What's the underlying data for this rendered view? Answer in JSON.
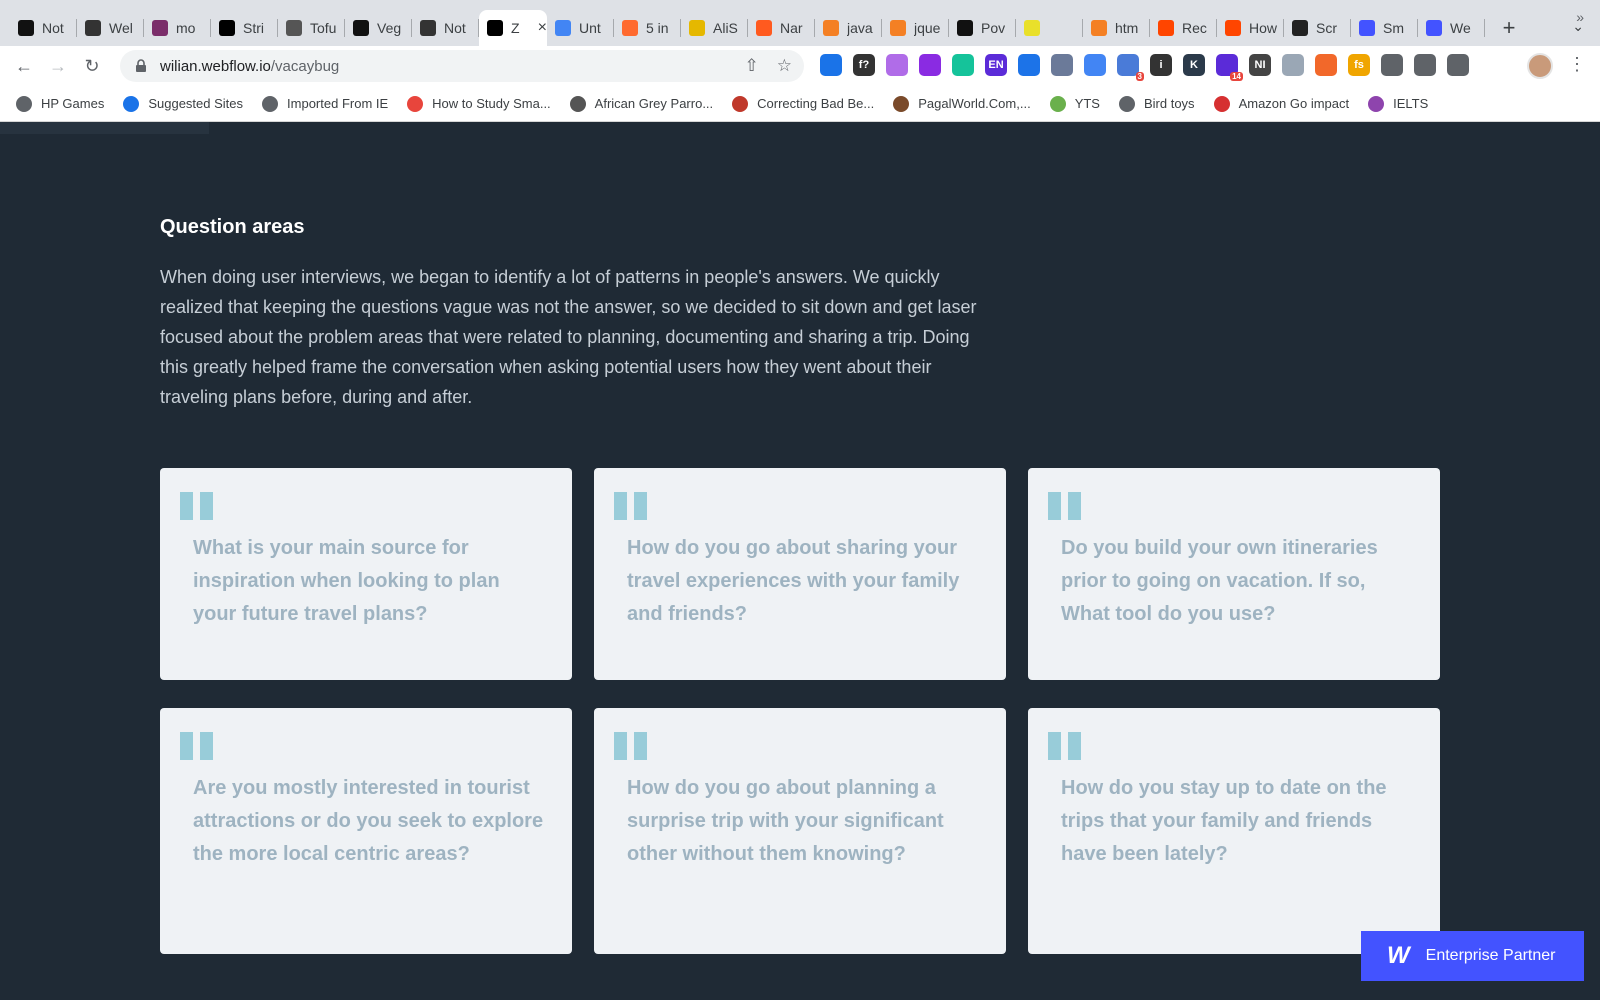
{
  "browser": {
    "tabs": [
      {
        "label": "Not",
        "icon": "notion-black-icon",
        "color": "#111111"
      },
      {
        "label": "Wel",
        "icon": "notion-icon",
        "color": "#333333"
      },
      {
        "label": "mo",
        "icon": "triangle-logo-icon",
        "color": "#7b2d6a"
      },
      {
        "label": "Stri",
        "icon": "wix-icon",
        "color": "#000000"
      },
      {
        "label": "Tofu",
        "icon": "book-icon",
        "color": "#555555"
      },
      {
        "label": "Veg",
        "icon": "k-circle-icon",
        "color": "#111111"
      },
      {
        "label": "Not",
        "icon": "hexagon-icon",
        "color": "#333333"
      },
      {
        "label": "Z",
        "icon": "z-logo-icon",
        "color": "#000000"
      },
      {
        "label": "Unt",
        "icon": "google-docs-icon",
        "color": "#4285f4"
      },
      {
        "label": "5 in",
        "icon": "orange-square-icon",
        "color": "#ff6a2f"
      },
      {
        "label": "AliS",
        "icon": "yellow-logo-icon",
        "color": "#e5b800"
      },
      {
        "label": "Nar",
        "icon": "orange-chart-icon",
        "color": "#ff5a1f"
      },
      {
        "label": "java",
        "icon": "stackoverflow-icon",
        "color": "#f48024"
      },
      {
        "label": "jque",
        "icon": "stackoverflow-icon",
        "color": "#f48024"
      },
      {
        "label": "Pov",
        "icon": "black-slash-icon",
        "color": "#111111"
      },
      {
        "label": "",
        "icon": "yellow-oval-icon",
        "color": "#e9e02a"
      },
      {
        "label": "htm",
        "icon": "stackoverflow-icon",
        "color": "#f48024"
      },
      {
        "label": "Rec",
        "icon": "reddit-icon",
        "color": "#ff4500"
      },
      {
        "label": "How",
        "icon": "reddit-icon",
        "color": "#ff4500"
      },
      {
        "label": "Scr",
        "icon": "w-square-icon",
        "color": "#222222"
      },
      {
        "label": "Sm",
        "icon": "webflow-w-icon",
        "color": "#4353ff"
      },
      {
        "label": "We",
        "icon": "webflow-w-outline-icon",
        "color": "#4353ff"
      }
    ],
    "active_tab_index": 7,
    "url_host": "wilian.webflow.io",
    "url_path": "/vacaybug",
    "extensions": [
      {
        "name": "pen-tool-icon",
        "color": "#1a73e8"
      },
      {
        "name": "f-question-icon",
        "color": "#333333",
        "text": "f?"
      },
      {
        "name": "gradient-blob-icon",
        "color": "#b06ce8"
      },
      {
        "name": "purple-w-icon",
        "color": "#8a2be2"
      },
      {
        "name": "grammarly-icon",
        "color": "#15c39a"
      },
      {
        "name": "en-circle-icon",
        "color": "#5b2bd8",
        "text": "EN"
      },
      {
        "name": "checkbox-icon",
        "color": "#1c73e8"
      },
      {
        "name": "screen-icon",
        "color": "#6b7a99"
      },
      {
        "name": "google-translate-icon",
        "color": "#4285f4"
      },
      {
        "name": "starburst-icon",
        "color": "#4a7bd8",
        "badge": "3"
      },
      {
        "name": "info-i-icon",
        "color": "#333333",
        "text": "i"
      },
      {
        "name": "k-dark-icon",
        "color": "#2b3a4a",
        "text": "K"
      },
      {
        "name": "grad-cap-icon",
        "color": "#5b2bd8",
        "badge": "14"
      },
      {
        "name": "ni-icon",
        "color": "#444444",
        "text": "NI"
      },
      {
        "name": "shield-icon",
        "color": "#9aa7b5"
      },
      {
        "name": "lighthouse-icon",
        "color": "#f2682a"
      },
      {
        "name": "fs-icon",
        "color": "#f0a500",
        "text": "fs"
      },
      {
        "name": "puzzle-icon",
        "color": "#5f6368"
      },
      {
        "name": "media-control-icon",
        "color": "#5f6368"
      },
      {
        "name": "sidepanel-icon",
        "color": "#5f6368"
      }
    ],
    "bookmarks": [
      {
        "label": "HP Games",
        "icon": "globe-icon",
        "color": "#5f6368"
      },
      {
        "label": "Suggested Sites",
        "icon": "search-icon",
        "color": "#1a73e8"
      },
      {
        "label": "Imported From IE",
        "icon": "folder-icon",
        "color": "#5f6368"
      },
      {
        "label": "How to Study Sma...",
        "icon": "chart-logo-icon",
        "color": "#e8453c"
      },
      {
        "label": "African Grey Parro...",
        "icon": "parrot-icon",
        "color": "#555555"
      },
      {
        "label": "Correcting Bad Be...",
        "icon": "paw-icon",
        "color": "#c0392b"
      },
      {
        "label": "PagalWorld.Com,...",
        "icon": "face-icon",
        "color": "#7a4a2a"
      },
      {
        "label": "YTS",
        "icon": "yts-icon",
        "color": "#6ab04c"
      },
      {
        "label": "Bird toys",
        "icon": "globe-icon",
        "color": "#5f6368"
      },
      {
        "label": "Amazon Go impact",
        "icon": "presentation-icon",
        "color": "#d63031"
      },
      {
        "label": "IELTS",
        "icon": "feather-icon",
        "color": "#8e44ad"
      }
    ],
    "bookmarks_more": "»"
  },
  "section": {
    "title": "Question areas",
    "body": "When doing user interviews, we began to identify a lot of patterns in people's answers. We quickly realized that keeping the questions vague was not the answer, so we decided to sit down and get laser focused about the problem areas that were related to planning, documenting and sharing a trip. Doing this greatly helped frame the conversation when asking potential users how they went about their traveling plans before, during and after."
  },
  "questions": [
    "What is your main source for inspiration when looking to plan your future travel plans?",
    "How do you go about sharing your travel experiences with your family and friends?",
    "Do you build your own itineraries prior to going on vacation. If so, What tool do you use?",
    "Are you mostly interested in tourist attractions or do you seek to explore the more local centric areas?",
    "How do you go about planning a surprise trip with your significant other without them knowing?",
    "How do you stay up to date on the trips that your family and friends have been lately?"
  ],
  "enterprise_badge": {
    "logo": "W",
    "label": "Enterprise Partner"
  },
  "colors": {
    "page_bg": "#1f2a35",
    "card_bg": "#eff2f5",
    "quote_mark": "#98ccd9",
    "question_text": "#9eb3c1",
    "badge_bg": "#4353ff"
  }
}
